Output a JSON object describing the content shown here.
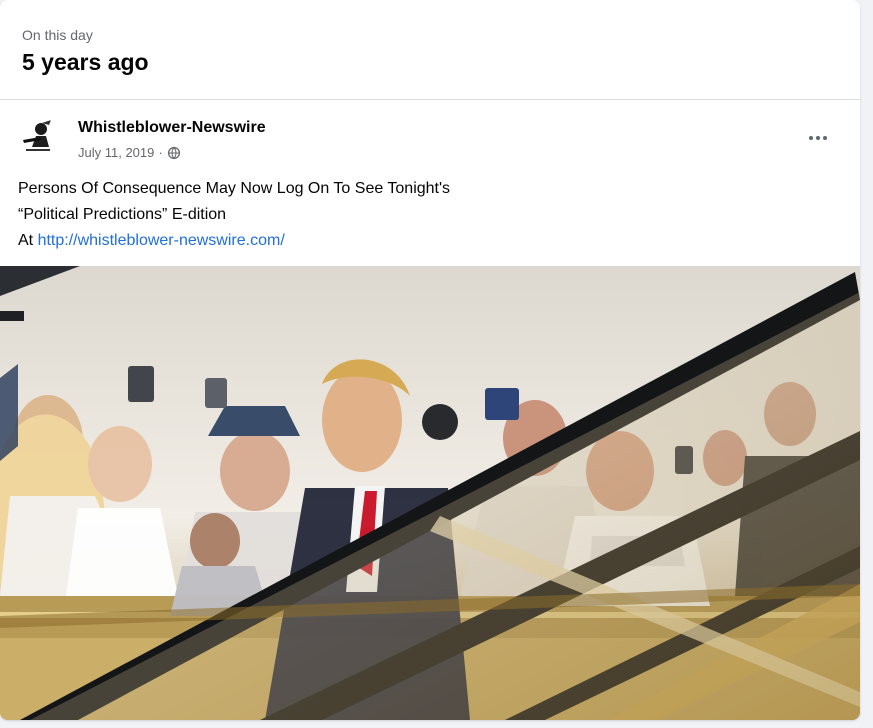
{
  "memory": {
    "kicker": "On this day",
    "title": "5 years ago"
  },
  "post": {
    "author": "Whistleblower-Newswire",
    "date": "July 11, 2019",
    "separator": "·",
    "audience_icon": "globe-icon",
    "more_icon": "more-horizontal-icon",
    "text": {
      "line1": "Persons Of Consequence May Now Log On To See Tonight's",
      "line2": "“Political Predictions” E-dition",
      "line3_prefix": "At ",
      "link": "http://whistleblower-newswire.com/"
    }
  },
  "colors": {
    "link": "#216fdb",
    "secondary_text": "#65676b",
    "divider": "#dadde1"
  }
}
